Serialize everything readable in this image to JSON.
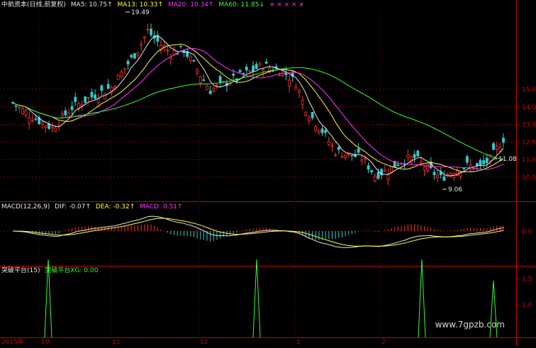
{
  "colors": {
    "background": "#000000",
    "up_candle": "#ff3030",
    "down_candle": "#33cccc",
    "ma5": "#e6e6e6",
    "ma13": "#ffff33",
    "ma20": "#ff33ff",
    "ma60": "#33ff33",
    "axis_red": "#cc0000",
    "grid": "#7a0000"
  },
  "main_panel": {
    "title": "中航资本(日线,前复权)",
    "ma5": "MA5: 10.75↑",
    "ma13": "MA13: 10.33↑",
    "ma20": "MA20: 10.34↑",
    "ma60": "MA60: 11.85↓",
    "markers": "×  ×  ×  ×  ×"
  },
  "macd_panel": {
    "title": "MACD(12,26,9)",
    "dif": "DIF: -0.07↑",
    "dea": "DEA: -0.32↑",
    "macd": "MACD: 0.51↑"
  },
  "indicator_panel": {
    "title": "突破平台(15)",
    "xg": "突破平台XG: 0.00"
  },
  "watermark": "www.7gpzb.com",
  "chart_data": {
    "type": "candlestick",
    "title": "中航资本(日线,前复权)",
    "y_ticks": [
      "15.0",
      "14.0",
      "13.0",
      "12.0",
      "11.0",
      "10.0"
    ],
    "ylim": [
      9.0,
      15.5
    ],
    "annotations": [
      {
        "label": "19.49",
        "value": 19.49
      },
      {
        "label": "11.08",
        "value": 11.08
      },
      {
        "label": "9.06",
        "value": 9.06
      }
    ],
    "x_labels": [
      "2015年",
      "10",
      "11",
      "12",
      "1",
      "2"
    ],
    "ohlc_overlay_label": "前复权",
    "macd_ticks": [
      "0.0"
    ],
    "indicator_ticks": [
      "1.5",
      "1.0"
    ],
    "indicator_signals": [
      1,
      1,
      1,
      1
    ]
  }
}
